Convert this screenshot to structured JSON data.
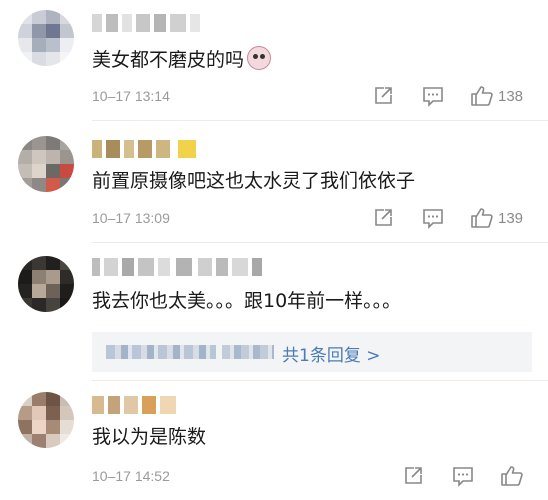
{
  "comments": [
    {
      "text": "美女都不磨皮的吗",
      "has_emoji": true,
      "emoji_name": "face-emoji",
      "time": "10–17 13:14",
      "like_count": "138"
    },
    {
      "text": "前置原摄像吧这也太水灵了我们依依子",
      "has_emoji": false,
      "time": "10–17 13:09",
      "like_count": "139"
    },
    {
      "text": "我去你也太美。。。跟10年前一样。。。",
      "has_emoji": false,
      "reply_link": "共1条回复 >"
    },
    {
      "text": "我以为是陈数",
      "has_emoji": false,
      "time": "10–17 14:52",
      "like_count": ""
    }
  ],
  "colors": {
    "timestamp": "#9a9a9a",
    "link": "#4a7bb7",
    "icon": "#888888",
    "divider": "#ececec"
  }
}
